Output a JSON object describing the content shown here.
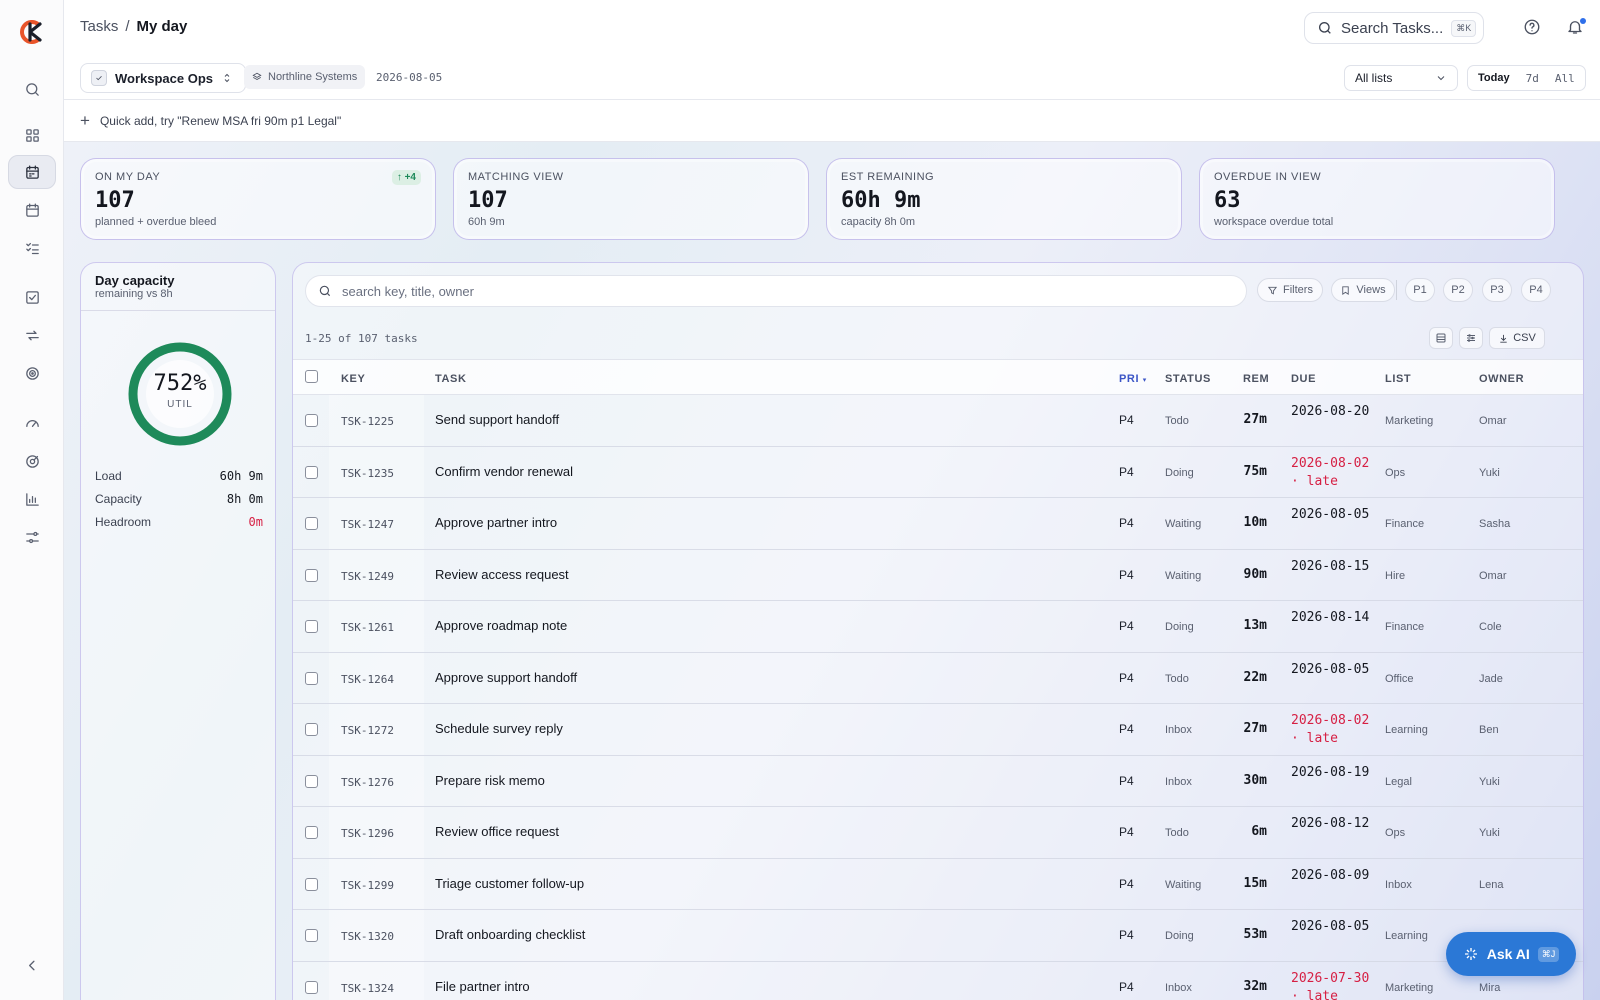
{
  "header": {
    "breadcrumb_root": "Tasks",
    "breadcrumb_sep": "/",
    "breadcrumb_current": "My day",
    "search_label": "Search Tasks...",
    "search_shortcut": "⌘K"
  },
  "toolbar": {
    "workspace": "Workspace Ops",
    "org": "Northline Systems",
    "date": "2026-08-05",
    "list_filter": "All lists",
    "range_today": "Today",
    "range_7d": "7d",
    "range_all": "All"
  },
  "quick_add": {
    "placeholder": "Quick add, try \"Renew MSA fri 90m p1 Legal\""
  },
  "stats": [
    {
      "label": "ON MY DAY",
      "value": "107",
      "sub": "planned + overdue bleed",
      "badge": "↑ +4"
    },
    {
      "label": "MATCHING VIEW",
      "value": "107",
      "sub": "60h 9m"
    },
    {
      "label": "EST REMAINING",
      "value": "60h 9m",
      "sub": "capacity 8h 0m"
    },
    {
      "label": "OVERDUE IN VIEW",
      "value": "63",
      "sub": "workspace overdue total"
    }
  ],
  "capacity": {
    "title": "Day capacity",
    "subtitle": "remaining vs 8h",
    "util_pct": "752%",
    "util_label": "UTIL",
    "util_fraction": 1.0,
    "ring_color": "#1e8a5a",
    "load_label": "Load",
    "load_value": "60h 9m",
    "capacity_label": "Capacity",
    "capacity_value": "8h 0m",
    "headroom_label": "Headroom",
    "headroom_value": "0m"
  },
  "table": {
    "search_placeholder": "search key, title, owner",
    "filters_label": "Filters",
    "views_label": "Views",
    "priorities": [
      "P1",
      "P2",
      "P3",
      "P4"
    ],
    "count": "1-25 of 107 tasks",
    "csv_label": "CSV",
    "columns": {
      "key": "KEY",
      "task": "TASK",
      "pri": "PRI",
      "status": "STATUS",
      "rem": "REM",
      "due": "DUE",
      "list": "LIST",
      "owner": "OWNER"
    },
    "rows": [
      {
        "key": "TSK-1225",
        "task": "Send support handoff",
        "pri": "P4",
        "status": "Todo",
        "rem": "27m",
        "due": "2026-08-20",
        "late": false,
        "list": "Marketing",
        "owner": "Omar"
      },
      {
        "key": "TSK-1235",
        "task": "Confirm vendor renewal",
        "pri": "P4",
        "status": "Doing",
        "rem": "75m",
        "due": "2026-08-02 · late",
        "late": true,
        "list": "Ops",
        "owner": "Yuki"
      },
      {
        "key": "TSK-1247",
        "task": "Approve partner intro",
        "pri": "P4",
        "status": "Waiting",
        "rem": "10m",
        "due": "2026-08-05",
        "late": false,
        "list": "Finance",
        "owner": "Sasha"
      },
      {
        "key": "TSK-1249",
        "task": "Review access request",
        "pri": "P4",
        "status": "Waiting",
        "rem": "90m",
        "due": "2026-08-15",
        "late": false,
        "list": "Hire",
        "owner": "Omar"
      },
      {
        "key": "TSK-1261",
        "task": "Approve roadmap note",
        "pri": "P4",
        "status": "Doing",
        "rem": "13m",
        "due": "2026-08-14",
        "late": false,
        "list": "Finance",
        "owner": "Cole"
      },
      {
        "key": "TSK-1264",
        "task": "Approve support handoff",
        "pri": "P4",
        "status": "Todo",
        "rem": "22m",
        "due": "2026-08-05",
        "late": false,
        "list": "Office",
        "owner": "Jade"
      },
      {
        "key": "TSK-1272",
        "task": "Schedule survey reply",
        "pri": "P4",
        "status": "Inbox",
        "rem": "27m",
        "due": "2026-08-02 · late",
        "late": true,
        "list": "Learning",
        "owner": "Ben"
      },
      {
        "key": "TSK-1276",
        "task": "Prepare risk memo",
        "pri": "P4",
        "status": "Inbox",
        "rem": "30m",
        "due": "2026-08-19",
        "late": false,
        "list": "Legal",
        "owner": "Yuki"
      },
      {
        "key": "TSK-1296",
        "task": "Review office request",
        "pri": "P4",
        "status": "Todo",
        "rem": "6m",
        "due": "2026-08-12",
        "late": false,
        "list": "Ops",
        "owner": "Yuki"
      },
      {
        "key": "TSK-1299",
        "task": "Triage customer follow-up",
        "pri": "P4",
        "status": "Waiting",
        "rem": "15m",
        "due": "2026-08-09",
        "late": false,
        "list": "Inbox",
        "owner": "Lena"
      },
      {
        "key": "TSK-1320",
        "task": "Draft onboarding checklist",
        "pri": "P4",
        "status": "Doing",
        "rem": "53m",
        "due": "2026-08-05",
        "late": false,
        "list": "Learning",
        "owner": ""
      },
      {
        "key": "TSK-1324",
        "task": "File partner intro",
        "pri": "P4",
        "status": "Inbox",
        "rem": "32m",
        "due": "2026-07-30 · late",
        "late": true,
        "list": "Marketing",
        "owner": "Mira"
      }
    ]
  },
  "ask_ai": {
    "label": "Ask AI",
    "shortcut": "⌘J"
  },
  "colors": {
    "accent": "#2b78d6",
    "late": "#d61f43",
    "ring": "#1e8a5a"
  }
}
